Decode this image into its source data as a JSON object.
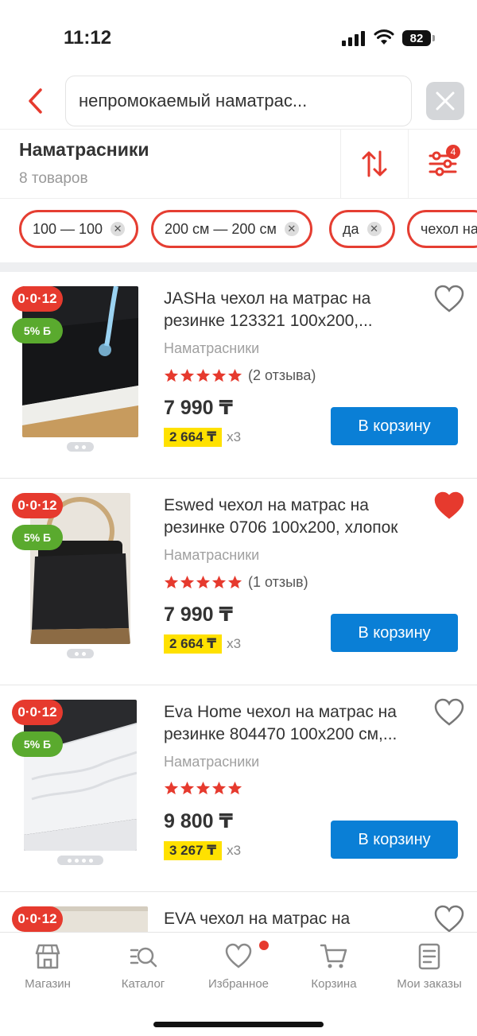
{
  "status_bar": {
    "time": "11:12",
    "battery": "82"
  },
  "search": {
    "query": "непромокаемый наматрас..."
  },
  "category": {
    "title": "Наматрасники",
    "count": "8 товаров",
    "filter_count": "4"
  },
  "chips": [
    {
      "label": "100 — 100"
    },
    {
      "label": "200 см — 200 см"
    },
    {
      "label": "да"
    },
    {
      "label": "чехол на"
    }
  ],
  "products": [
    {
      "title": "JASHа чехол на матрас на резинке 123321 100х200,...",
      "category": "Наматрасники",
      "rating": 5,
      "reviews": "(2 отзыва)",
      "price": "7 990 ₸",
      "installment": "2 664 ₸",
      "term": "x3",
      "badge_installment": "0·0·12",
      "badge_bonus": "5% Б",
      "favorite": false,
      "cart_label": "В корзину",
      "images": 2
    },
    {
      "title": "Eswed чехол на матрас на резинке 0706 100х200, хлопок",
      "category": "Наматрасники",
      "rating": 5,
      "reviews": "(1 отзыв)",
      "price": "7 990 ₸",
      "installment": "2 664 ₸",
      "term": "x3",
      "badge_installment": "0·0·12",
      "badge_bonus": "5% Б",
      "favorite": true,
      "cart_label": "В корзину",
      "images": 2
    },
    {
      "title": "Eva Home чехол на матрас на резинке 804470 100х200 см,...",
      "category": "Наматрасники",
      "rating": 5,
      "reviews": "",
      "price": "9 800 ₸",
      "installment": "3 267 ₸",
      "term": "x3",
      "badge_installment": "0·0·12",
      "badge_bonus": "5% Б",
      "favorite": false,
      "cart_label": "В корзину",
      "images": 4
    },
    {
      "title": "EVA чехол на матрас на",
      "badge_installment": "0·0·12",
      "favorite": false
    }
  ],
  "tabbar": [
    {
      "label": "Магазин",
      "icon": "shop-icon"
    },
    {
      "label": "Каталог",
      "icon": "catalog-icon"
    },
    {
      "label": "Избранное",
      "icon": "heart-icon"
    },
    {
      "label": "Корзина",
      "icon": "cart-icon"
    },
    {
      "label": "Мои заказы",
      "icon": "orders-icon"
    }
  ],
  "colors": {
    "accent_red": "#e63a2e",
    "button_blue": "#0a7fd6",
    "bonus_green": "#5aaa2e",
    "installment_yellow": "#ffe100"
  }
}
